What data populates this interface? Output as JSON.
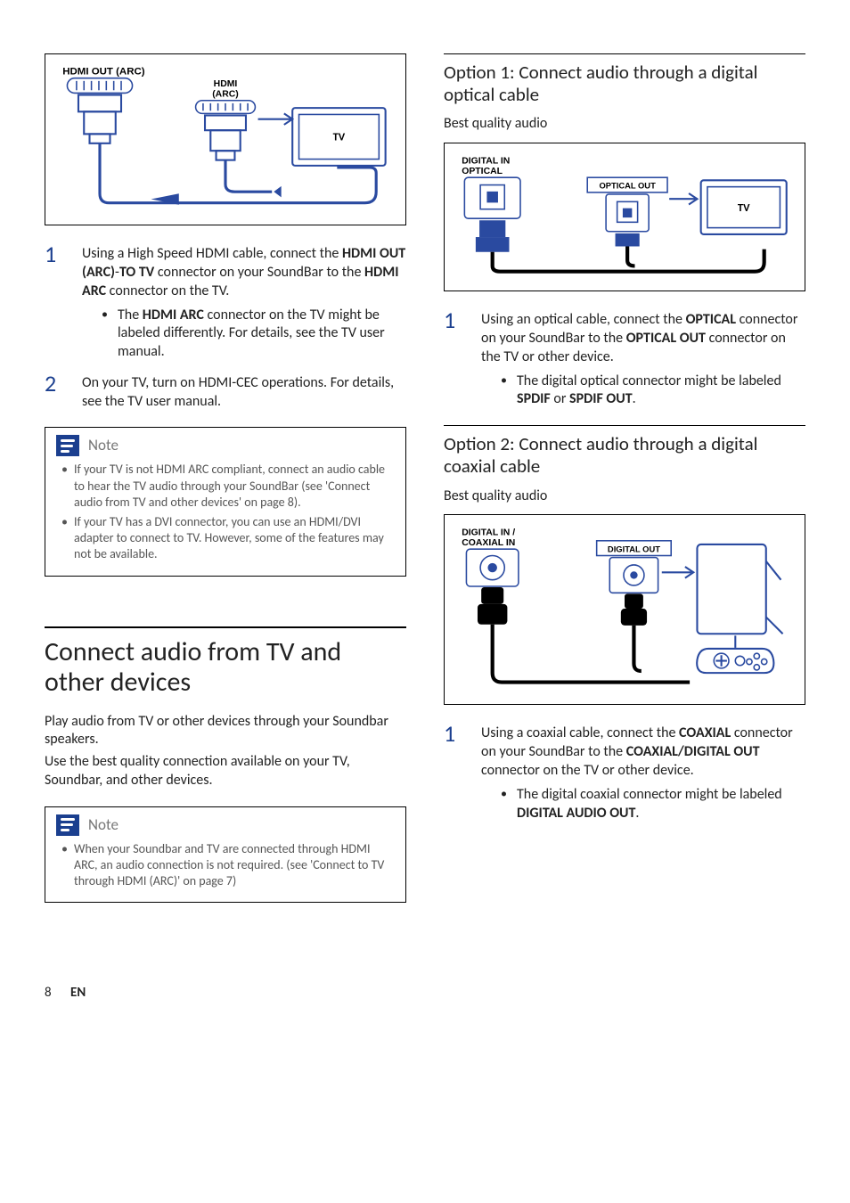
{
  "left": {
    "diagram1": {
      "port_out": "HDMI OUT (ARC)",
      "port_in": "HDMI (ARC)",
      "device": "TV"
    },
    "steps": [
      {
        "pre": "Using a High Speed HDMI cable, connect the ",
        "b1": "HDMI OUT (ARC)",
        "mid1": "-",
        "b2": "TO TV",
        "mid2": " connector on your SoundBar to the ",
        "b3": "HDMI ARC",
        "post": " connector on the TV.",
        "sub_pre": "The ",
        "sub_b": "HDMI ARC",
        "sub_post": " connector on the TV might be labeled differently. For details, see the TV user manual."
      },
      {
        "text": "On your TV, turn on HDMI-CEC operations. For details, see the TV user manual."
      }
    ],
    "note1_title": "Note",
    "note1_items": [
      "If your TV is not HDMI ARC compliant, connect an audio cable to hear the TV audio through your SoundBar (see 'Connect audio from TV and other devices' on page 8).",
      "If your TV has a DVI connector, you can use an HDMI/DVI adapter to connect to TV. However, some of the features may not be available."
    ],
    "h1": "Connect audio from TV and other devices",
    "p1": "Play audio from TV or other devices through your Soundbar speakers.",
    "p2": "Use the best quality connection available on your TV, Soundbar, and other devices.",
    "note2_title": "Note",
    "note2_items": [
      "When your Soundbar and TV are connected through HDMI ARC, an audio connection is not required. (see 'Connect to TV through HDMI (ARC)' on page 7)"
    ]
  },
  "right": {
    "opt1_h": "Option 1: Connect audio through a digital optical cable",
    "opt1_sub": "Best quality audio",
    "diagram2": {
      "port_in": "DIGITAL IN OPTICAL",
      "port_out": "OPTICAL OUT",
      "device": "TV"
    },
    "opt1_step_pre": "Using an optical cable, connect the ",
    "opt1_step_b1": "OPTICAL",
    "opt1_step_mid": " connector on your SoundBar to the ",
    "opt1_step_b2": "OPTICAL OUT",
    "opt1_step_post": " connector on the TV or other device.",
    "opt1_sub_pre": "The digital optical connector might be labeled ",
    "opt1_sub_b1": "SPDIF",
    "opt1_sub_mid": " or ",
    "opt1_sub_b2": "SPDIF OUT",
    "opt1_sub_post": ".",
    "opt2_h": "Option 2: Connect audio through a digital coaxial cable",
    "opt2_sub": "Best quality audio",
    "diagram3": {
      "port_in": "DIGITAL IN / COAXIAL IN",
      "port_out": "DIGITAL OUT"
    },
    "opt2_step_pre": "Using a coaxial cable, connect the ",
    "opt2_step_b1": "COAXIAL",
    "opt2_step_mid": " connector on your SoundBar to the ",
    "opt2_step_b2": "COAXIAL/DIGITAL OUT",
    "opt2_step_post": " connector on the TV or other device.",
    "opt2_sub_pre": "The digital coaxial connector might be labeled ",
    "opt2_sub_b1": "DIGITAL AUDIO OUT",
    "opt2_sub_post": "."
  },
  "footer": {
    "page": "8",
    "lang": "EN"
  }
}
